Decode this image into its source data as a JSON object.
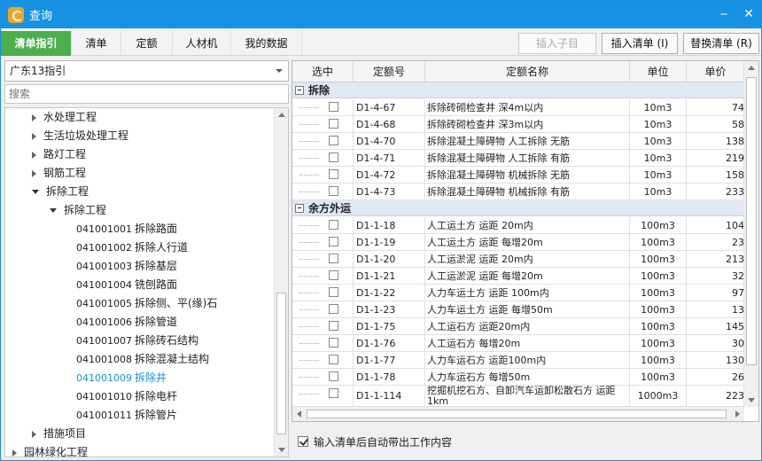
{
  "window": {
    "title": "查询"
  },
  "tabs": [
    "清单指引",
    "清单",
    "定额",
    "人材机",
    "我的数据"
  ],
  "toolbar": {
    "insert_child": "插入子目",
    "insert_list": "插入清单 (I)",
    "replace_list": "替换清单 (R)"
  },
  "left": {
    "combo_value": "广东13指引",
    "search_placeholder": "搜索",
    "tree": [
      {
        "label": "水处理工程",
        "level": 1,
        "state": "closed"
      },
      {
        "label": "生活垃圾处理工程",
        "level": 1,
        "state": "closed"
      },
      {
        "label": "路灯工程",
        "level": 1,
        "state": "closed"
      },
      {
        "label": "钢筋工程",
        "level": 1,
        "state": "closed"
      },
      {
        "label": "拆除工程",
        "level": 1,
        "state": "open"
      },
      {
        "label": "拆除工程",
        "level": 2,
        "state": "open"
      },
      {
        "code": "041001001",
        "label": "拆除路面",
        "level": 3
      },
      {
        "code": "041001002",
        "label": "拆除人行道",
        "level": 3
      },
      {
        "code": "041001003",
        "label": "拆除基层",
        "level": 3
      },
      {
        "code": "041001004",
        "label": "铣刨路面",
        "level": 3
      },
      {
        "code": "041001005",
        "label": "拆除侧、平(缘)石",
        "level": 3
      },
      {
        "code": "041001006",
        "label": "拆除管道",
        "level": 3
      },
      {
        "code": "041001007",
        "label": "拆除砖石结构",
        "level": 3
      },
      {
        "code": "041001008",
        "label": "拆除混凝土结构",
        "level": 3
      },
      {
        "code": "041001009",
        "label": "拆除井",
        "level": 3,
        "selected": true
      },
      {
        "code": "041001010",
        "label": "拆除电杆",
        "level": 3
      },
      {
        "code": "041001011",
        "label": "拆除管片",
        "level": 3
      },
      {
        "label": "措施项目",
        "level": 1,
        "state": "closed"
      },
      {
        "label": "园林绿化工程",
        "level": 0,
        "state": "closed"
      }
    ]
  },
  "grid": {
    "headers": [
      "选中",
      "定额号",
      "定额名称",
      "单位",
      "单价"
    ],
    "groups": [
      {
        "name": "拆除",
        "rows": [
          [
            "D1-4-67",
            "拆除砖砌检查井 深4m以内",
            "10m3",
            "74"
          ],
          [
            "D1-4-68",
            "拆除砖砌检查井 深3m以内",
            "10m3",
            "58"
          ],
          [
            "D1-4-70",
            "拆除混凝土障碍物 人工拆除 无筋",
            "10m3",
            "138"
          ],
          [
            "D1-4-71",
            "拆除混凝土障碍物 人工拆除 有筋",
            "10m3",
            "219"
          ],
          [
            "D1-4-72",
            "拆除混凝土障碍物 机械拆除 无筋",
            "10m3",
            "158"
          ],
          [
            "D1-4-73",
            "拆除混凝土障碍物 机械拆除 有筋",
            "10m3",
            "233"
          ]
        ]
      },
      {
        "name": "余方外运",
        "rows": [
          [
            "D1-1-18",
            "人工运土方 运距 20m内",
            "100m3",
            "104"
          ],
          [
            "D1-1-19",
            "人工运土方 运距 每增20m",
            "100m3",
            "23"
          ],
          [
            "D1-1-20",
            "人工运淤泥 运距 20m内",
            "100m3",
            "213"
          ],
          [
            "D1-1-21",
            "人工运淤泥 运距 每增20m",
            "100m3",
            "32"
          ],
          [
            "D1-1-22",
            "人力车运土方 运距 100m内",
            "100m3",
            "97"
          ],
          [
            "D1-1-23",
            "人力车运土方 运距 每增50m",
            "100m3",
            "13"
          ],
          [
            "D1-1-75",
            "人工运石方 运距20m内",
            "100m3",
            "145"
          ],
          [
            "D1-1-76",
            "人工运石方 每增20m",
            "100m3",
            "30"
          ],
          [
            "D1-1-77",
            "人力车运石方 运距100m内",
            "100m3",
            "130"
          ],
          [
            "D1-1-78",
            "人力车运石方 每增50m",
            "100m3",
            "26"
          ],
          [
            "D1-1-114",
            "挖掘机挖石方、自卸汽车运卸松散石方 运距1km",
            "1000m3",
            "223"
          ]
        ]
      }
    ]
  },
  "footer": {
    "auto_content_label": "输入清单后自动带出工作内容"
  }
}
